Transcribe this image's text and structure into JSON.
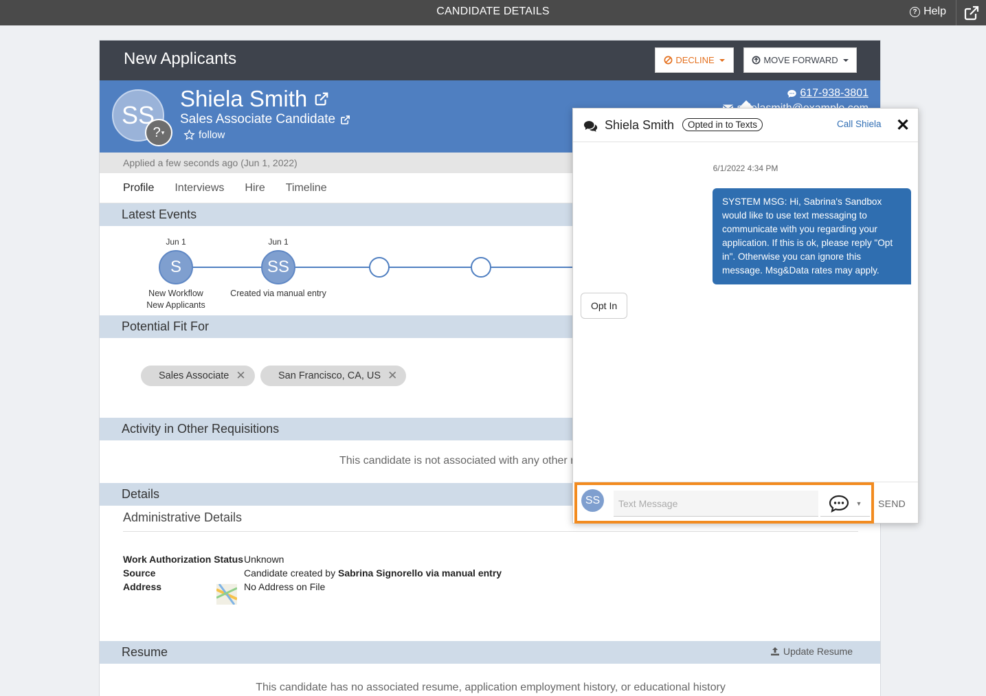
{
  "topbar": {
    "title": "CANDIDATE DETAILS",
    "help": "Help"
  },
  "card": {
    "stage": "New Applicants",
    "decline_label": "DECLINE",
    "forward_label": "MOVE FORWARD"
  },
  "candidate": {
    "initials": "SS",
    "name": "Shiela Smith",
    "job": "Sales Associate Candidate",
    "follow": "follow",
    "phone": "617-938-3801",
    "email": "shielasmith@example.com",
    "applied": "Applied a few seconds ago (Jun 1, 2022)"
  },
  "tabs": [
    "Profile",
    "Interviews",
    "Hire",
    "Timeline"
  ],
  "sections": {
    "latest_events": "Latest Events",
    "potential_fit": "Potential Fit For",
    "activity_other": "Activity in Other Requisitions",
    "details": "Details",
    "resume": "Resume"
  },
  "timeline": [
    {
      "date": "Jun 1",
      "initials": "S",
      "label1": "New Workflow",
      "label2": "New Applicants"
    },
    {
      "date": "Jun 1",
      "initials": "SS",
      "label1": "Created via manual entry",
      "label2": ""
    }
  ],
  "fit_chips": [
    "Sales Associate",
    "San Francisco, CA, US"
  ],
  "activity_other_msg": "This candidate is not associated with any other requisitions",
  "details": {
    "admin_title": "Administrative Details",
    "work_auth_label": "Work Authorization Status",
    "work_auth_value": "Unknown",
    "source_label": "Source",
    "source_prefix": "Candidate created by ",
    "source_bold": "Sabrina Signorello via manual entry",
    "address_label": "Address",
    "address_value": "No Address on File"
  },
  "resume": {
    "update": "Update Resume",
    "empty_msg": "This candidate has no associated resume, application employment history, or educational history"
  },
  "chat": {
    "name": "Shiela Smith",
    "opted": "Opted in to Texts",
    "call": "Call Shiela",
    "timestamp": "6/1/2022 4:34 PM",
    "outgoing": "SYSTEM MSG: Hi, Sabrina's Sandbox would like to use text messaging to communicate with you regarding your application. If this is ok, please reply \"Opt in\". Otherwise you can ignore this message. Msg&Data rates may apply.",
    "incoming": "Opt In",
    "input_placeholder": "Text Message",
    "send": "SEND",
    "avatar": "SS"
  },
  "colors": {
    "accent_blue": "#4f7fc1",
    "decline_orange": "#e4701e",
    "highlight_orange": "#f28b1f",
    "bubble_blue": "#2f6eb0"
  }
}
